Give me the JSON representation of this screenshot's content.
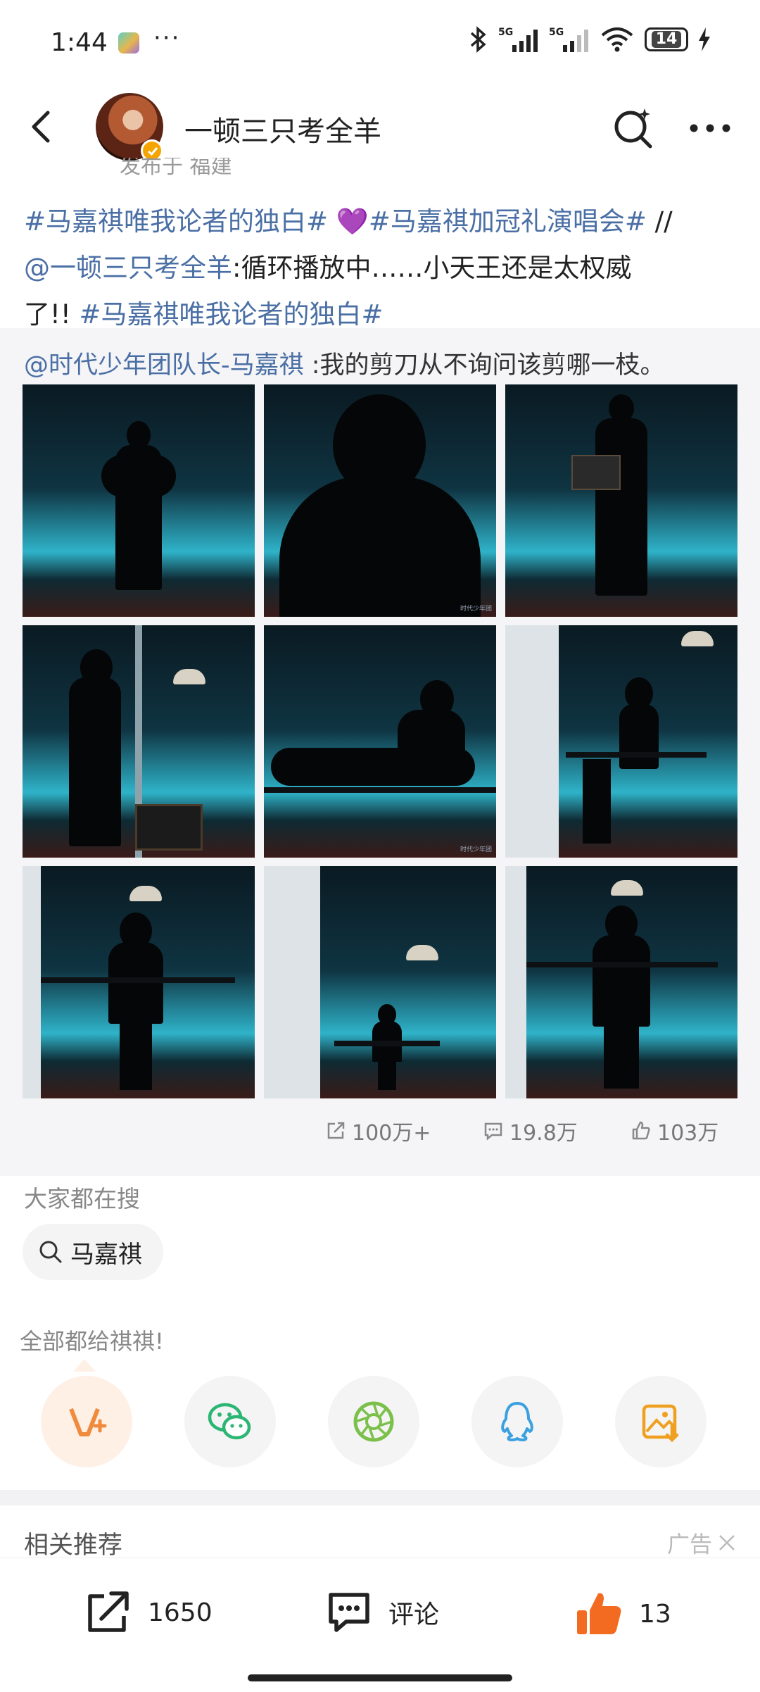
{
  "status_bar": {
    "time": "1:44",
    "dots": "···",
    "battery": "14"
  },
  "nav": {
    "title": "一顿三只考全羊"
  },
  "post": {
    "location_partial": "发布于 福建",
    "line1_tag1": "#马嘉祺唯我论者的独白#",
    "line1_heart": "💜",
    "line1_tag2": "#马嘉祺加冠礼演唱会#",
    "line1_slash": " //",
    "line2_mention": "@一顿三只考全羊",
    "line2_text": ":循环播放中……小天王还是太权威",
    "line3_text": "了!! ",
    "line3_tag": "#马嘉祺唯我论者的独白#"
  },
  "repost": {
    "mention": "@时代少年团队长-马嘉祺",
    "text": " :我的剪刀从不询问该剪哪一枝。",
    "photos_count": 9,
    "stats": {
      "share": "100万+",
      "comments": "19.8万",
      "likes": "103万"
    }
  },
  "search_section": {
    "heading": "大家都在搜",
    "pill": "马嘉祺"
  },
  "share_section": {
    "heading": "全部都给祺祺!",
    "buttons": [
      "weibo-repost",
      "wechat",
      "moments",
      "qq",
      "save-image"
    ]
  },
  "related": {
    "heading": "相关推荐",
    "ad_label": "广告"
  },
  "bottom_bar": {
    "repost_count": "1650",
    "comment_label": "评论",
    "like_count": "13"
  },
  "colors": {
    "tag": "#4a6fa5",
    "like_orange": "#f26b21",
    "wechat_green": "#2bb673",
    "qq_blue": "#3aa0e0"
  }
}
